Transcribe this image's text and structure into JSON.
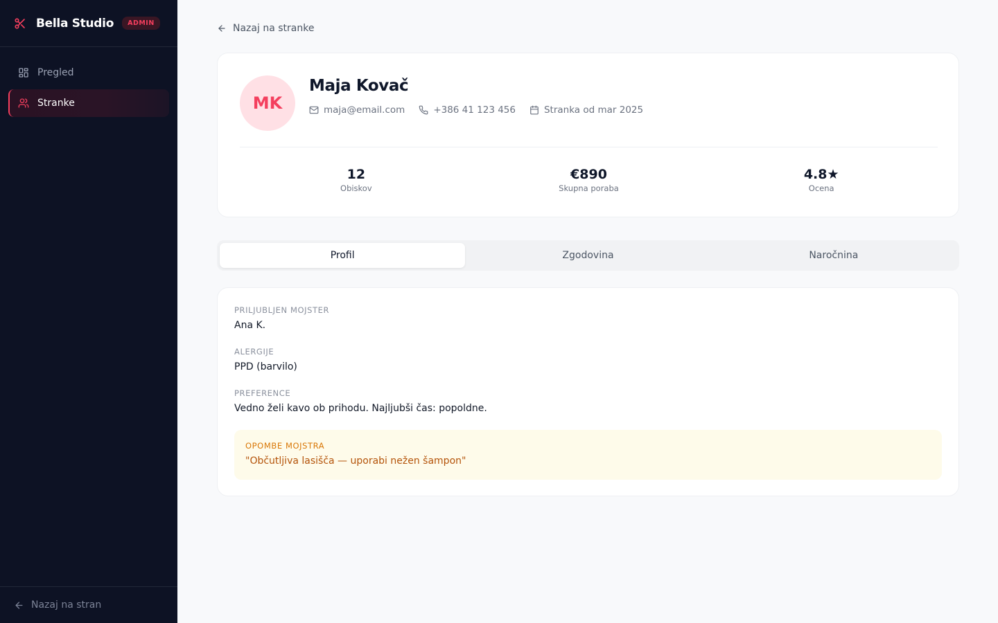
{
  "sidebar": {
    "brand": "Bella Studio",
    "badge": "ADMIN",
    "items": [
      {
        "label": "Pregled",
        "icon": "dashboard-icon"
      },
      {
        "label": "Stranke",
        "icon": "users-icon",
        "active": true
      }
    ],
    "footer_link": "Nazaj na stran"
  },
  "main": {
    "back_link": "Nazaj na stranke",
    "client": {
      "initials": "MK",
      "name": "Maja Kovač",
      "email": "maja@email.com",
      "phone": "+386 41 123 456",
      "since": "Stranka od mar 2025"
    },
    "stats": [
      {
        "value": "12",
        "label": "Obiskov"
      },
      {
        "value": "€890",
        "label": "Skupna poraba"
      },
      {
        "value": "4.8★",
        "label": "Ocena"
      }
    ],
    "tabs": [
      {
        "label": "Profil",
        "active": true
      },
      {
        "label": "Zgodovina"
      },
      {
        "label": "Naročnina"
      }
    ],
    "profile": {
      "preferred_master_label": "Priljubljen mojster",
      "preferred_master": "Ana K.",
      "allergies_label": "Alergije",
      "allergies": "PPD (barvilo)",
      "preferences_label": "Preference",
      "preferences": "Vedno želi kavo ob prihodu. Najljubši čas: popoldne.",
      "notes_label": "Opombe mojstra",
      "notes": "\"Občutljiva lasišča — uporabi nežen šampon\""
    }
  },
  "colors": {
    "accent": "#f43f5e",
    "sidebar_bg": "#0d1224",
    "page_bg": "#f8f9fb",
    "note_bg": "#fefbea",
    "note_text": "#b45309"
  }
}
